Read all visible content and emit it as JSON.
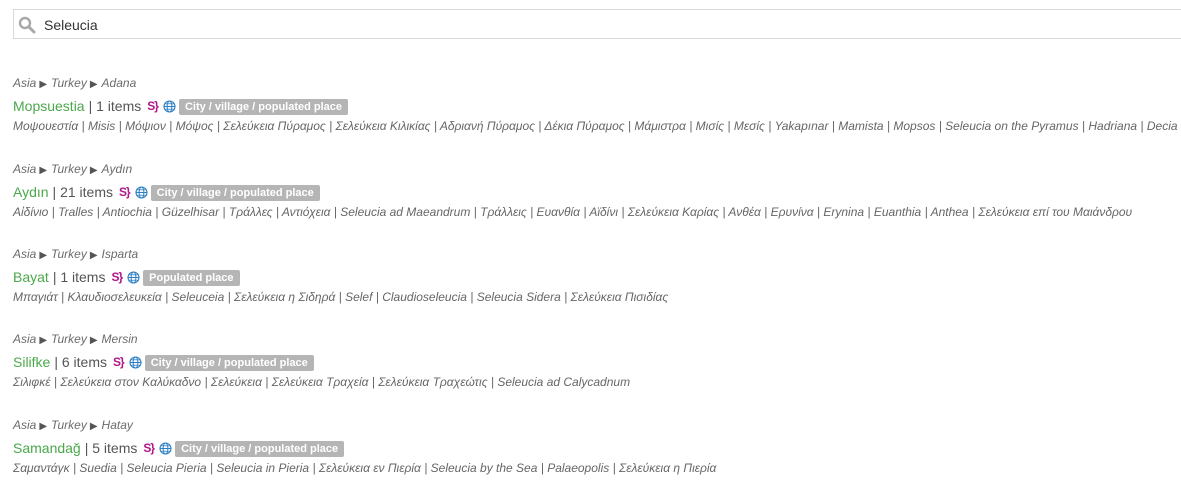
{
  "search": {
    "value": "Seleucia"
  },
  "results": [
    {
      "crumbs": [
        "Asia",
        "Turkey",
        "Adana"
      ],
      "name": "Mopsuestia",
      "count": "| 1 items",
      "badge": "City / village / populated place",
      "names": "Μοψουεστία | Misis | Μόψιον | Μόψος | Σελεύκεια Πύραμος | Σελεύκεια Κιλικίας | Αδριανή Πύραμος | Δέκια Πύραμος | Μάμιστρα | Μισίς | Μεσίς | Yakapınar | Mamista | Mopsos | Seleucia on the Pyramus | Hadriana | Decia"
    },
    {
      "crumbs": [
        "Asia",
        "Turkey",
        "Aydın"
      ],
      "name": "Aydın",
      "count": "| 21 items",
      "badge": "City / village / populated place",
      "names": "Aἰδίνιο | Tralles | Antiochia | Güzelhisar | Τράλλες | Αντιόχεια | Seleucia ad Maeandrum | Τράλλεις | Ευανθία | Αϊδίνι | Σελεύκεια Καρίας | Ανθέα | Ερυνίνα | Erynina | Euanthia | Anthea | Σελεύκεια επί του Μαιάνδρου"
    },
    {
      "crumbs": [
        "Asia",
        "Turkey",
        "Isparta"
      ],
      "name": "Bayat",
      "count": "| 1 items",
      "badge": "Populated place",
      "names": "Μπαγιάτ | Κλαυδιοσελευκεία | Seleuceia | Σελεύκεια η Σιδηρά | Selef | Claudioseleucia | Seleucia Sidera | Σελεύκεια Πισιδίας"
    },
    {
      "crumbs": [
        "Asia",
        "Turkey",
        "Mersin"
      ],
      "name": "Silifke",
      "count": "| 6 items",
      "badge": "City / village / populated place",
      "names": "Σιλιφκέ | Σελεύκεια στον Καλύκαδνο | Σελεύκεια | Σελεύκεια Τραχεία | Σελεύκεια Τραχεώτις | Seleucia ad Calycadnum"
    },
    {
      "crumbs": [
        "Asia",
        "Turkey",
        "Hatay"
      ],
      "name": "Samandağ",
      "count": "| 5 items",
      "badge": "City / village / populated place",
      "names": "Σαμαντάγκ | Suedia | Seleucia Pieria | Seleucia in Pieria | Σελεύκεια εν Πιερία | Seleucia by the Sea | Palaeopolis | Σελεύκεια η Πιερία"
    }
  ],
  "icons": {
    "s_glyph": "S}",
    "search": "search-icon",
    "globe": "globe-icon"
  },
  "colors": {
    "place_link": "#4aa84b",
    "s_icon": "#b0178a",
    "globe": "#2d7fc4",
    "badge_bg": "#b5b5b5"
  }
}
